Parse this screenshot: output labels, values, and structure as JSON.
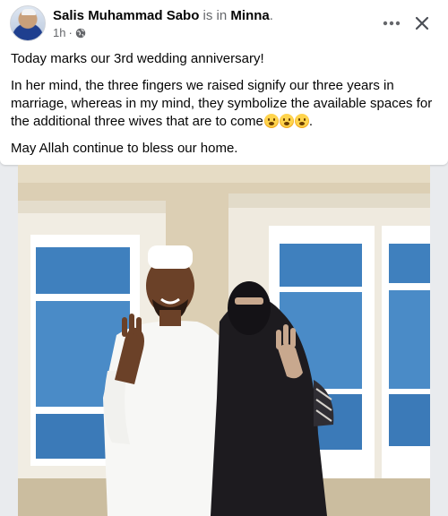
{
  "post": {
    "author": "Salis Muhammad Sabo",
    "is_in": "is in",
    "location": "Minna",
    "location_suffix": ".",
    "timestamp": "1h",
    "separator": "·",
    "paragraphs": [
      "Today marks our 3rd wedding anniversary!",
      "In her mind, the three fingers we raised signify our three years in marriage, whereas in my mind, they symbolize the available spaces for the additional three wives that are to come",
      "May Allah continue to bless our home."
    ],
    "paragraph2_end": "."
  },
  "icons": {
    "privacy": "globe-icon",
    "more": "more-horizontal-icon",
    "close": "close-icon",
    "emoji": "flushed-face-emoji"
  },
  "colors": {
    "secondary_text": "#65676b",
    "card_bg": "#ffffff",
    "page_bg": "#e9ebee"
  },
  "photo": {
    "alt": ""
  }
}
